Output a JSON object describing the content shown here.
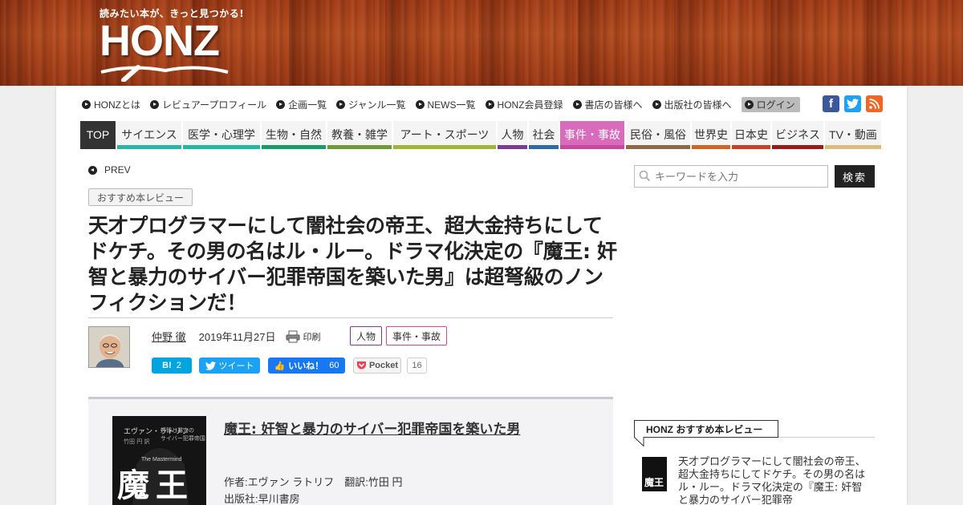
{
  "header": {
    "tagline": "読みたい本が、きっと見つかる!",
    "logo_text": "HONZ"
  },
  "util_nav": [
    {
      "label": "HONZとは"
    },
    {
      "label": "レビュアープロフィール"
    },
    {
      "label": "企画一覧"
    },
    {
      "label": "ジャンル一覧"
    },
    {
      "label": "NEWS一覧"
    },
    {
      "label": "HONZ会員登録"
    },
    {
      "label": "書店の皆様へ"
    },
    {
      "label": "出版社の皆様へ"
    },
    {
      "label": "ログイン"
    }
  ],
  "social": {
    "facebook": {
      "glyph": "f",
      "color": "#3b5998"
    },
    "twitter": {
      "glyph": "t",
      "color": "#1da1f2"
    },
    "rss": {
      "glyph": "rss",
      "color": "#f26522"
    }
  },
  "categories": [
    {
      "label": "TOP",
      "color": "#333333"
    },
    {
      "label": "サイエンス",
      "color": "#2bb5a3"
    },
    {
      "label": "医学・心理学",
      "color": "#24b89c"
    },
    {
      "label": "生物・自然",
      "color": "#189a6a"
    },
    {
      "label": "教養・雑学",
      "color": "#6e9b3a"
    },
    {
      "label": "アート・スポーツ",
      "color": "#a3b43a"
    },
    {
      "label": "人物",
      "color": "#7a3c92"
    },
    {
      "label": "社会",
      "color": "#2c6aa8"
    },
    {
      "label": "事件・事故",
      "color": "#c54a9f"
    },
    {
      "label": "民俗・風俗",
      "color": "#8d6a46"
    },
    {
      "label": "世界史",
      "color": "#d0652a"
    },
    {
      "label": "日本史",
      "color": "#c9402a"
    },
    {
      "label": "ビジネス",
      "color": "#9a1b1b"
    },
    {
      "label": "TV・動画",
      "color": "#d9bd7e"
    }
  ],
  "article": {
    "prev_label": "PREV",
    "review_tag": "おすすめ本レビュー",
    "title": "天才プログラマーにして闇社会の帝王、超大金持ちにしてドケチ。その男の名はル・ルー。ドラマ化決定の『魔王: 奸智と暴力のサイバー犯罪帝国を築いた男』は超弩級のノンフィクションだ！",
    "author": "仲野 徹",
    "date": "2019年11月27日",
    "print_label": "印刷",
    "tags": [
      {
        "label": "人物",
        "color": "#7a3c92"
      },
      {
        "label": "事件・事故",
        "color": "#c54a9f"
      }
    ],
    "share": {
      "hatena_label": "B!",
      "hatena_count": "2",
      "tweet_label": "ツイート",
      "like_label": "いいね！",
      "like_count": "60",
      "pocket_label": "Pocket",
      "pocket_count": "16"
    }
  },
  "book": {
    "title": "魔王: 奸智と暴力のサイバー犯罪帝国を築いた男",
    "credits": "作者:エヴァン ラトリフ　翻訳:竹田 円",
    "publisher": "出版社:早川書房",
    "cover_title": "魔王",
    "cover_en": "The Mastermind"
  },
  "sidebar": {
    "search_placeholder": "キーワードを入力",
    "search_button": "検索",
    "heading": "HONZ おすすめ本レビュー",
    "item_text": "天才プログラマーにして闇社会の帝王、超大金持ちにしてドケチ。その男の名はル・ルー。ドラマ化決定の『魔王: 奸智と暴力のサイバー犯罪帝"
  }
}
